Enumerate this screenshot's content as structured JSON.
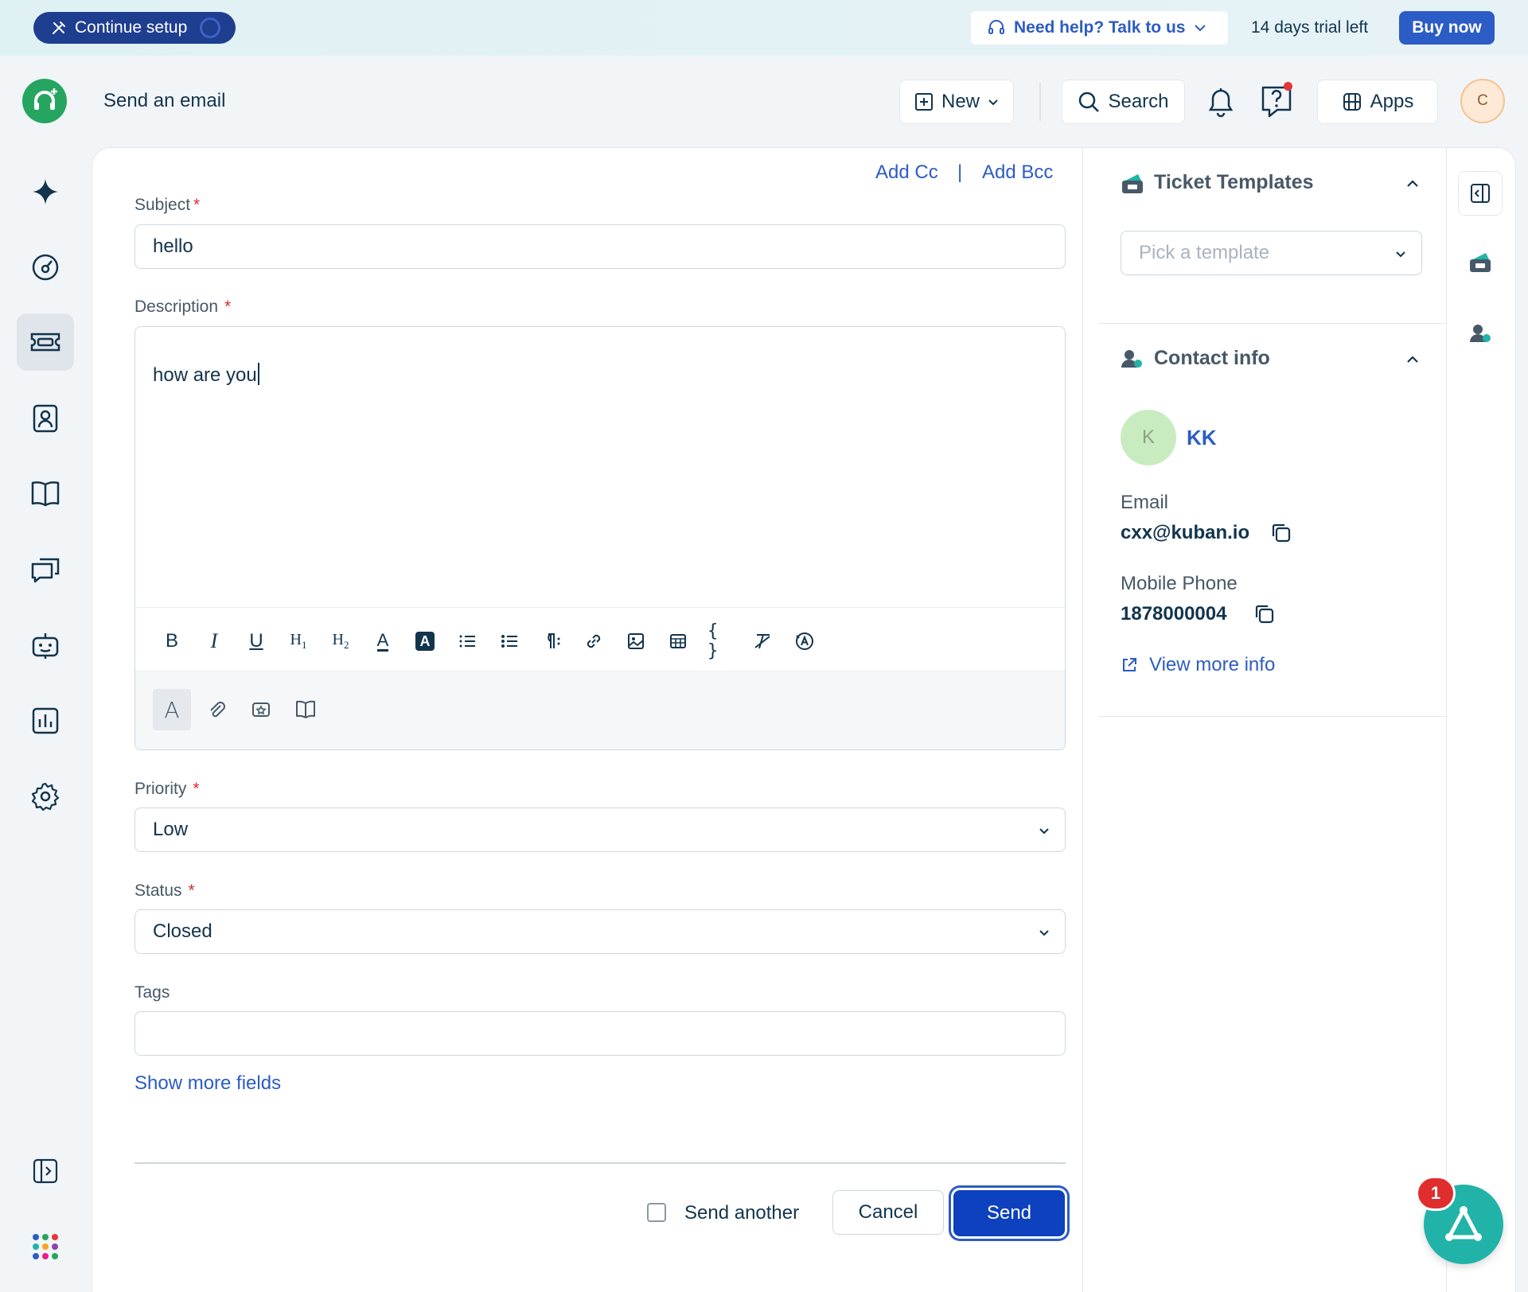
{
  "banner": {
    "continue_setup": "Continue setup",
    "need_help": "Need help? Talk to us",
    "trial": "14 days trial left",
    "buy_now": "Buy now"
  },
  "header": {
    "title": "Send an email",
    "new_label": "New",
    "search_label": "Search",
    "apps_label": "Apps",
    "avatar_initial": "C"
  },
  "nav": {
    "items": [
      "freddy-ai",
      "dashboard",
      "tickets",
      "contacts",
      "solutions",
      "conversations",
      "bots",
      "analytics",
      "admin-settings"
    ],
    "active": "tickets"
  },
  "form": {
    "add_cc": "Add Cc",
    "separator": "|",
    "add_bcc": "Add Bcc",
    "subject_label": "Subject",
    "subject_value": "hello",
    "description_label": "Description",
    "description_value": "how are you",
    "priority_label": "Priority",
    "priority_value": "Low",
    "status_label": "Status",
    "status_value": "Closed",
    "tags_label": "Tags",
    "tags_value": "",
    "required_mark": "*",
    "show_more": "Show more fields",
    "send_another": "Send another",
    "cancel": "Cancel",
    "send": "Send"
  },
  "toolbar": {
    "h1": "H",
    "h1_sub": "1",
    "h2": "H",
    "h2_sub": "2",
    "bold": "B",
    "italic": "I",
    "underline": "U",
    "text_color": "A",
    "bg_color": "A",
    "code": "{ }",
    "font_toggle": "A"
  },
  "sidebar": {
    "templates_title": "Ticket Templates",
    "template_placeholder": "Pick a template",
    "contact_title": "Contact info",
    "contact_initial": "K",
    "contact_name": "KK",
    "email_label": "Email",
    "email_value": "cxx@kuban.io",
    "phone_label": "Mobile Phone",
    "phone_value": "1878000004",
    "view_more": "View more info"
  },
  "widget": {
    "badge_count": "1"
  },
  "colors": {
    "brand_blue": "#2c5cc5",
    "send_blue": "#0e41bd",
    "logo_green": "#25a55f",
    "widget_teal": "#21b3a8",
    "required_red": "#d72d30"
  }
}
